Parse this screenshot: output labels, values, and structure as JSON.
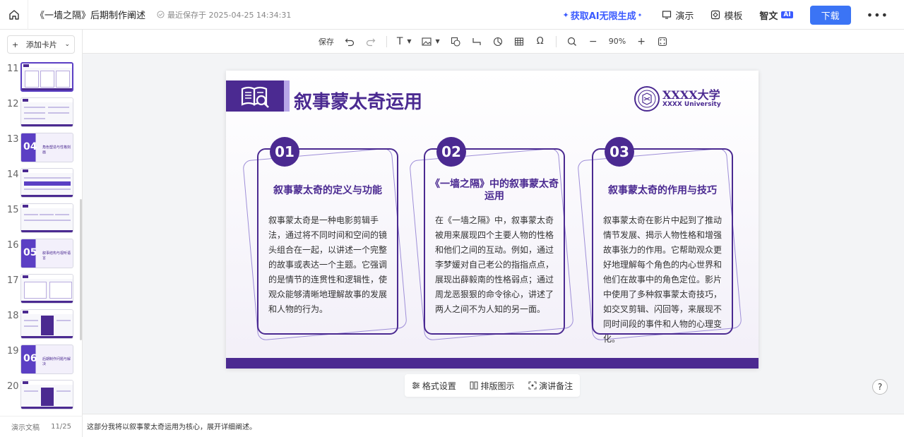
{
  "header": {
    "doc_title": "《一墙之隔》后期制作阐述",
    "saved_text": "最近保存于 2025-04-25 14:34:31",
    "ai_link": "获取AI无限生成",
    "present": "演示",
    "template": "模板",
    "zhiwen": "智文",
    "zhiwen_badge": "AI",
    "download": "下载"
  },
  "leftpanel": {
    "add_card": "添加卡片",
    "thumb_numbers": [
      "11",
      "12",
      "13",
      "14",
      "15",
      "16",
      "17",
      "18",
      "19",
      "20"
    ],
    "section_13": "04",
    "section_13_text": "角色塑造与性格刻画",
    "section_16": "05",
    "section_16_text": "叙事结构与视听语言",
    "section_19": "06",
    "section_19_text": "后期制作问题与解决",
    "footer_label": "演示文稿",
    "footer_page": "11/25"
  },
  "toolbar": {
    "save": "保存",
    "zoom": "90%"
  },
  "slide": {
    "title": "叙事蒙太奇运用",
    "uni_name": "XXXX大学",
    "uni_en": "XXXX University",
    "cards": [
      {
        "num": "01",
        "title": "叙事蒙太奇的定义与功能",
        "body": "叙事蒙太奇是一种电影剪辑手法，通过将不同时间和空间的镜头组合在一起，以讲述一个完整的故事或表达一个主题。它强调的是情节的连贯性和逻辑性，使观众能够清晰地理解故事的发展和人物的行为。"
      },
      {
        "num": "02",
        "title": "《一墙之隔》中的叙事蒙太奇运用",
        "body": "在《一墙之隔》中，叙事蒙太奇被用来展现四个主要人物的性格和他们之间的互动。例如，通过李梦媛对自己老公的指指点点，展现出薛毅南的性格弱点；通过周龙恶狠狠的命令徐心，讲述了两人之间不为人知的另一面。"
      },
      {
        "num": "03",
        "title": "叙事蒙太奇的作用与技巧",
        "body": "叙事蒙太奇在影片中起到了推动情节发展、揭示人物性格和增强故事张力的作用。它帮助观众更好地理解每个角色的内心世界和他们在故事中的角色定位。影片中使用了多种叙事蒙太奇技巧，如交叉剪辑、闪回等，来展现不同时间段的事件和人物的心理变化。"
      }
    ]
  },
  "bottom_tools": {
    "format": "格式设置",
    "layout": "排版图示",
    "notes": "演讲备注"
  },
  "help": "?",
  "notes_text": "这部分我将以叙事蒙太奇运用为核心，展开详细阐述。",
  "colors": {
    "brand_purple": "#4b2a91",
    "accent_blue": "#3b74f5"
  }
}
